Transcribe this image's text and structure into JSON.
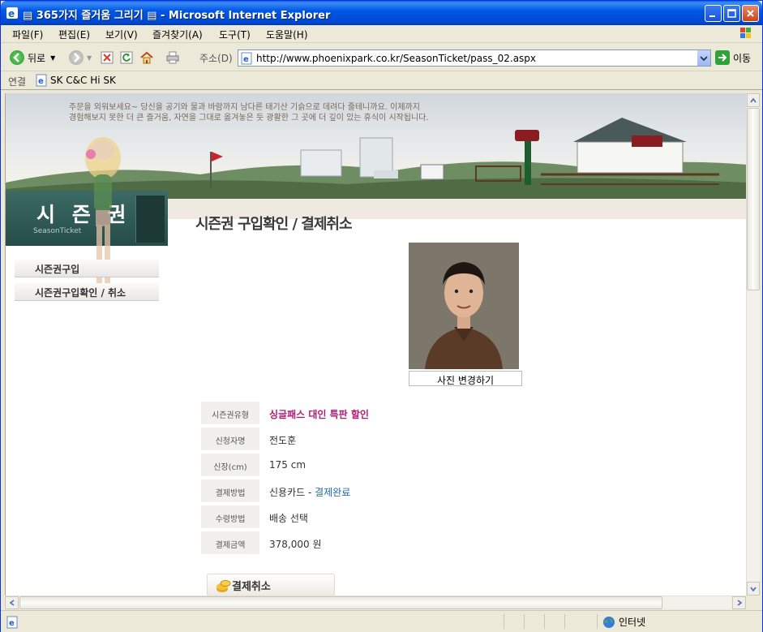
{
  "window": {
    "title": "▤ 365가지 즐거움 그리기 ▤ - Microsoft Internet Explorer"
  },
  "menu": {
    "items": [
      "파일(F)",
      "편집(E)",
      "보기(V)",
      "즐겨찾기(A)",
      "도구(T)",
      "도움말(H)"
    ]
  },
  "toolbar": {
    "back_label": "뒤로",
    "address_label": "주소(D)",
    "url": "http://www.phoenixpark.co.kr/SeasonTicket/pass_02.aspx",
    "go_label": "이동"
  },
  "links": {
    "label": "연결",
    "items": [
      "SK C&C Hi SK"
    ]
  },
  "banner": {
    "tagline_line1": "주문을 외워보세요~ 당신을 공기와 물과 바람까지 남다른 태기산 기슭으로 데려다 줄테니까요. 이제까지",
    "tagline_line2": "경험해보지 못한 더 큰 즐거움, 자연을 그대로 옮겨놓은 듯 광활한 그 곳에 더 깊이 있는 휴식이 시작됩니다."
  },
  "section": {
    "title_ko": "시 즌 권",
    "title_en": "SeasonTicket"
  },
  "side_menu": {
    "items": [
      "시즌권구입",
      "시즌권구입확인 / 취소"
    ]
  },
  "page": {
    "title": "시즌권 구입확인 / 결제취소",
    "change_photo_label": "사진 변경하기",
    "cancel_button_label": "결제취소"
  },
  "ticket_info": {
    "rows": [
      {
        "label": "시즌권유형",
        "value": "싱글패스 대인 특판 할인"
      },
      {
        "label": "신청자명",
        "value": "전도훈"
      },
      {
        "label": "신장(cm)",
        "value": "175 cm"
      },
      {
        "label": "결제방법",
        "value": "신용카드 - ",
        "status": "결제완료"
      },
      {
        "label": "수령방법",
        "value": "배송 선택"
      },
      {
        "label": "결제금액",
        "value": "378,000 원"
      }
    ]
  },
  "statusbar": {
    "zone_label": "인터넷"
  },
  "colors": {
    "titlebar": "#0058e6",
    "highlight_value": "#b01c73",
    "status_complete": "#1f6ab0",
    "section_box": "#2f5c57"
  }
}
